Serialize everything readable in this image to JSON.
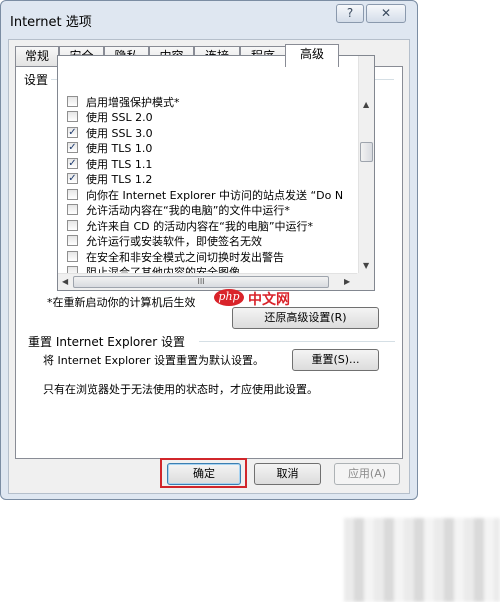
{
  "window": {
    "title": "Internet 选项",
    "help_glyph": "?",
    "close_glyph": "✕"
  },
  "tabs": [
    {
      "label": "常规"
    },
    {
      "label": "安全"
    },
    {
      "label": "隐私"
    },
    {
      "label": "内容"
    },
    {
      "label": "连接"
    },
    {
      "label": "程序"
    },
    {
      "label": "高级",
      "active": true
    }
  ],
  "settings": {
    "group_label": "设置",
    "items": [
      {
        "label": "启用增强保护模式*",
        "checked": false
      },
      {
        "label": "使用 SSL 2.0",
        "checked": false
      },
      {
        "label": "使用 SSL 3.0",
        "checked": true
      },
      {
        "label": "使用 TLS 1.0",
        "checked": true
      },
      {
        "label": "使用 TLS 1.1",
        "checked": true
      },
      {
        "label": "使用 TLS 1.2",
        "checked": true
      },
      {
        "label": "向你在 Internet Explorer 中访问的站点发送 “Do N",
        "checked": false
      },
      {
        "label": "允许活动内容在“我的电脑”的文件中运行*",
        "checked": false
      },
      {
        "label": "允许来自 CD 的活动内容在“我的电脑”中运行*",
        "checked": false
      },
      {
        "label": "允许运行或安装软件，即使签名无效",
        "checked": false
      },
      {
        "label": "在安全和非安全模式之间切换时发出警告",
        "checked": false
      },
      {
        "label": "阻止混合了其他内容的安全图像",
        "checked": false
      }
    ],
    "hscroll_grip": "III",
    "note": "*在重新启动你的计算机后生效",
    "restore_button": "还原高级设置(R)"
  },
  "reset": {
    "group_label": "重置 Internet Explorer 设置",
    "description": "将 Internet Explorer 设置重置为默认设置。",
    "button": "重置(S)...",
    "hint": "只有在浏览器处于无法使用的状态时，才应使用此设置。"
  },
  "footer": {
    "ok": "确定",
    "cancel": "取消",
    "apply": "应用(A)"
  },
  "watermark": {
    "logo": "php",
    "text": "中文网"
  },
  "colors": {
    "highlight": "#d1262b",
    "watermark": "#d9232a"
  }
}
